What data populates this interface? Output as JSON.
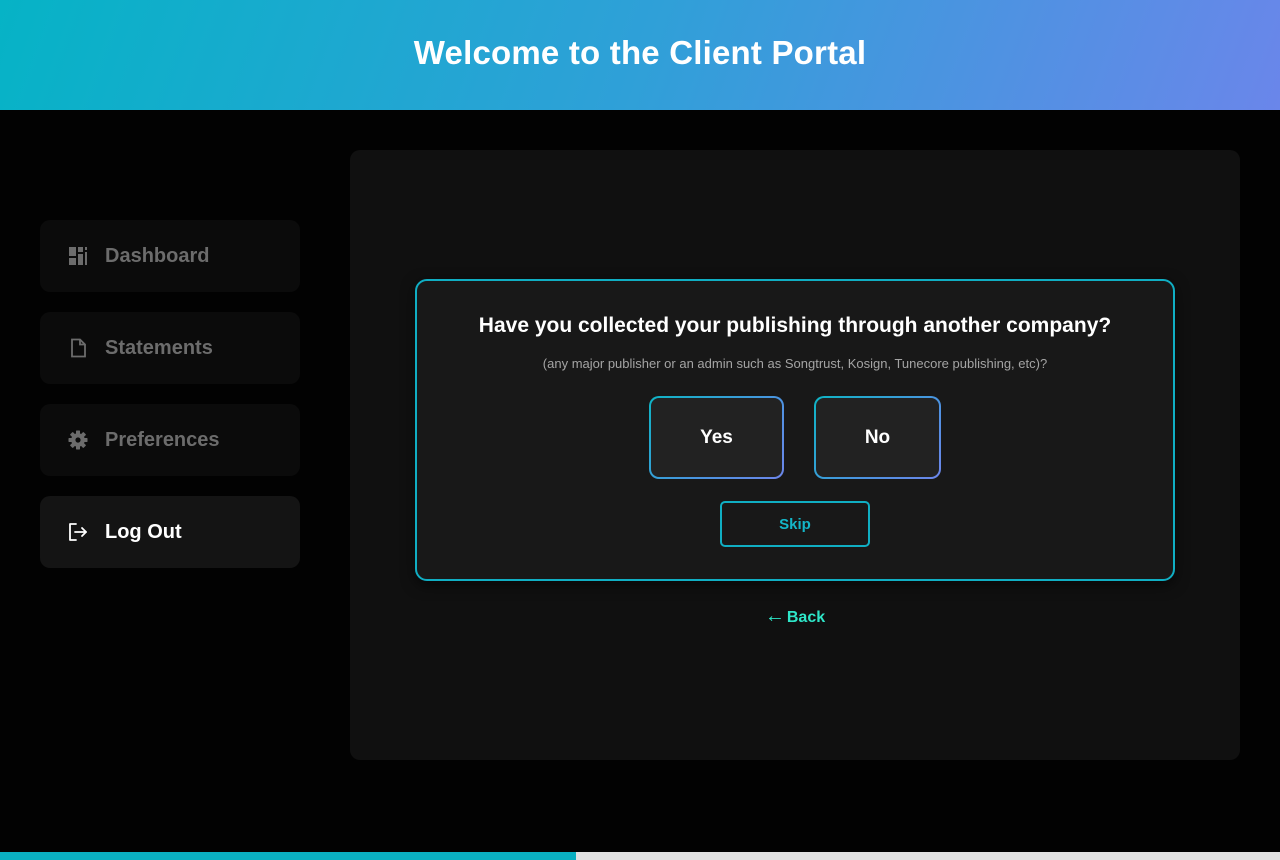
{
  "header": {
    "title": "Welcome to the Client Portal"
  },
  "sidebar": {
    "items": [
      {
        "label": "Dashboard",
        "icon": "dashboard-icon",
        "active": false
      },
      {
        "label": "Statements",
        "icon": "document-icon",
        "active": false
      },
      {
        "label": "Preferences",
        "icon": "gear-icon",
        "active": false
      },
      {
        "label": "Log Out",
        "icon": "logout-icon",
        "active": true
      }
    ]
  },
  "question": {
    "title": "Have you collected your publishing through another company?",
    "hint": "(any major publisher or an admin such as Songtrust, Kosign, Tunecore publishing, etc)?",
    "yes_label": "Yes",
    "no_label": "No",
    "skip_label": "Skip"
  },
  "back": {
    "arrow": "←",
    "label": "Back"
  },
  "progress": {
    "fraction": 0.45
  },
  "colors": {
    "accent": "#10aec3",
    "back_link": "#2ee6c8",
    "header_gradient_start": "#06b3c6",
    "header_gradient_end": "#6a86ea",
    "progress_track": "#e2e2e2"
  }
}
